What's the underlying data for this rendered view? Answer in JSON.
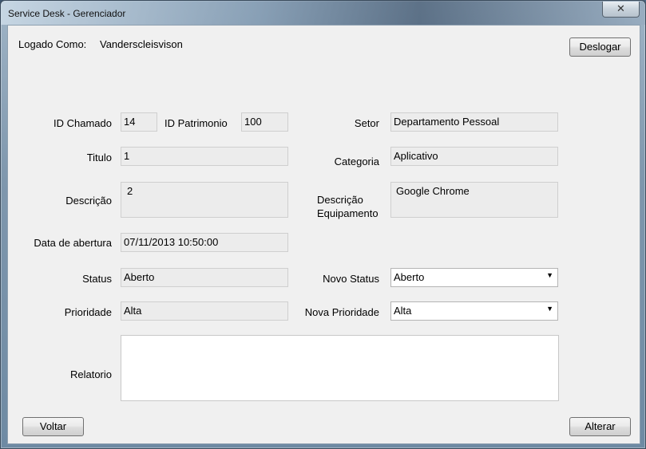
{
  "window": {
    "title": "Service Desk - Gerenciador",
    "close_glyph": "✕"
  },
  "header": {
    "logged_label": "Logado Como:",
    "user": "Vanderscleisvison",
    "logout_label": "Deslogar"
  },
  "fields": {
    "id_chamado": {
      "label": "ID Chamado",
      "value": "14"
    },
    "id_patrimonio": {
      "label": "ID Patrimonio",
      "value": "100"
    },
    "setor": {
      "label": "Setor",
      "value": "Departamento Pessoal"
    },
    "titulo": {
      "label": "Titulo",
      "value": "1"
    },
    "categoria": {
      "label": "Categoria",
      "value": "Aplicativo"
    },
    "descricao": {
      "label": "Descrição",
      "value": "2"
    },
    "descricao_equip": {
      "label_line1": "Descrição",
      "label_line2": "Equipamento",
      "value": "Google Chrome"
    },
    "data_abertura": {
      "label": "Data de abertura",
      "value": "07/11/2013 10:50:00"
    },
    "status": {
      "label": "Status",
      "value": "Aberto"
    },
    "novo_status": {
      "label": "Novo Status",
      "value": "Aberto"
    },
    "prioridade": {
      "label": "Prioridade",
      "value": "Alta"
    },
    "nova_prioridade": {
      "label": "Nova Prioridade",
      "value": "Alta"
    },
    "relatorio": {
      "label": "Relatorio",
      "value": ""
    }
  },
  "footer": {
    "back_label": "Voltar",
    "save_label": "Alterar"
  },
  "icons": {
    "dropdown": "chevron-down-icon",
    "close": "close-icon"
  },
  "colors": {
    "client_bg": "#f0f0f0",
    "readonly_field": "#ececec",
    "titlebar": "#8ea5ba"
  }
}
